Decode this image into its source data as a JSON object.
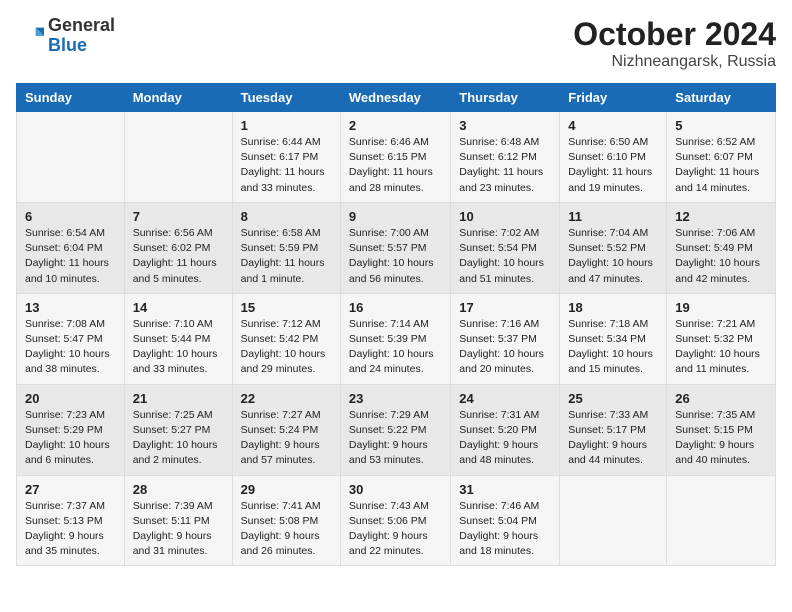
{
  "header": {
    "logo_general": "General",
    "logo_blue": "Blue",
    "month": "October 2024",
    "location": "Nizhneangarsk, Russia"
  },
  "weekdays": [
    "Sunday",
    "Monday",
    "Tuesday",
    "Wednesday",
    "Thursday",
    "Friday",
    "Saturday"
  ],
  "weeks": [
    [
      {
        "day": "",
        "info": ""
      },
      {
        "day": "",
        "info": ""
      },
      {
        "day": "1",
        "info": "Sunrise: 6:44 AM\nSunset: 6:17 PM\nDaylight: 11 hours\nand 33 minutes."
      },
      {
        "day": "2",
        "info": "Sunrise: 6:46 AM\nSunset: 6:15 PM\nDaylight: 11 hours\nand 28 minutes."
      },
      {
        "day": "3",
        "info": "Sunrise: 6:48 AM\nSunset: 6:12 PM\nDaylight: 11 hours\nand 23 minutes."
      },
      {
        "day": "4",
        "info": "Sunrise: 6:50 AM\nSunset: 6:10 PM\nDaylight: 11 hours\nand 19 minutes."
      },
      {
        "day": "5",
        "info": "Sunrise: 6:52 AM\nSunset: 6:07 PM\nDaylight: 11 hours\nand 14 minutes."
      }
    ],
    [
      {
        "day": "6",
        "info": "Sunrise: 6:54 AM\nSunset: 6:04 PM\nDaylight: 11 hours\nand 10 minutes."
      },
      {
        "day": "7",
        "info": "Sunrise: 6:56 AM\nSunset: 6:02 PM\nDaylight: 11 hours\nand 5 minutes."
      },
      {
        "day": "8",
        "info": "Sunrise: 6:58 AM\nSunset: 5:59 PM\nDaylight: 11 hours\nand 1 minute."
      },
      {
        "day": "9",
        "info": "Sunrise: 7:00 AM\nSunset: 5:57 PM\nDaylight: 10 hours\nand 56 minutes."
      },
      {
        "day": "10",
        "info": "Sunrise: 7:02 AM\nSunset: 5:54 PM\nDaylight: 10 hours\nand 51 minutes."
      },
      {
        "day": "11",
        "info": "Sunrise: 7:04 AM\nSunset: 5:52 PM\nDaylight: 10 hours\nand 47 minutes."
      },
      {
        "day": "12",
        "info": "Sunrise: 7:06 AM\nSunset: 5:49 PM\nDaylight: 10 hours\nand 42 minutes."
      }
    ],
    [
      {
        "day": "13",
        "info": "Sunrise: 7:08 AM\nSunset: 5:47 PM\nDaylight: 10 hours\nand 38 minutes."
      },
      {
        "day": "14",
        "info": "Sunrise: 7:10 AM\nSunset: 5:44 PM\nDaylight: 10 hours\nand 33 minutes."
      },
      {
        "day": "15",
        "info": "Sunrise: 7:12 AM\nSunset: 5:42 PM\nDaylight: 10 hours\nand 29 minutes."
      },
      {
        "day": "16",
        "info": "Sunrise: 7:14 AM\nSunset: 5:39 PM\nDaylight: 10 hours\nand 24 minutes."
      },
      {
        "day": "17",
        "info": "Sunrise: 7:16 AM\nSunset: 5:37 PM\nDaylight: 10 hours\nand 20 minutes."
      },
      {
        "day": "18",
        "info": "Sunrise: 7:18 AM\nSunset: 5:34 PM\nDaylight: 10 hours\nand 15 minutes."
      },
      {
        "day": "19",
        "info": "Sunrise: 7:21 AM\nSunset: 5:32 PM\nDaylight: 10 hours\nand 11 minutes."
      }
    ],
    [
      {
        "day": "20",
        "info": "Sunrise: 7:23 AM\nSunset: 5:29 PM\nDaylight: 10 hours\nand 6 minutes."
      },
      {
        "day": "21",
        "info": "Sunrise: 7:25 AM\nSunset: 5:27 PM\nDaylight: 10 hours\nand 2 minutes."
      },
      {
        "day": "22",
        "info": "Sunrise: 7:27 AM\nSunset: 5:24 PM\nDaylight: 9 hours\nand 57 minutes."
      },
      {
        "day": "23",
        "info": "Sunrise: 7:29 AM\nSunset: 5:22 PM\nDaylight: 9 hours\nand 53 minutes."
      },
      {
        "day": "24",
        "info": "Sunrise: 7:31 AM\nSunset: 5:20 PM\nDaylight: 9 hours\nand 48 minutes."
      },
      {
        "day": "25",
        "info": "Sunrise: 7:33 AM\nSunset: 5:17 PM\nDaylight: 9 hours\nand 44 minutes."
      },
      {
        "day": "26",
        "info": "Sunrise: 7:35 AM\nSunset: 5:15 PM\nDaylight: 9 hours\nand 40 minutes."
      }
    ],
    [
      {
        "day": "27",
        "info": "Sunrise: 7:37 AM\nSunset: 5:13 PM\nDaylight: 9 hours\nand 35 minutes."
      },
      {
        "day": "28",
        "info": "Sunrise: 7:39 AM\nSunset: 5:11 PM\nDaylight: 9 hours\nand 31 minutes."
      },
      {
        "day": "29",
        "info": "Sunrise: 7:41 AM\nSunset: 5:08 PM\nDaylight: 9 hours\nand 26 minutes."
      },
      {
        "day": "30",
        "info": "Sunrise: 7:43 AM\nSunset: 5:06 PM\nDaylight: 9 hours\nand 22 minutes."
      },
      {
        "day": "31",
        "info": "Sunrise: 7:46 AM\nSunset: 5:04 PM\nDaylight: 9 hours\nand 18 minutes."
      },
      {
        "day": "",
        "info": ""
      },
      {
        "day": "",
        "info": ""
      }
    ]
  ]
}
